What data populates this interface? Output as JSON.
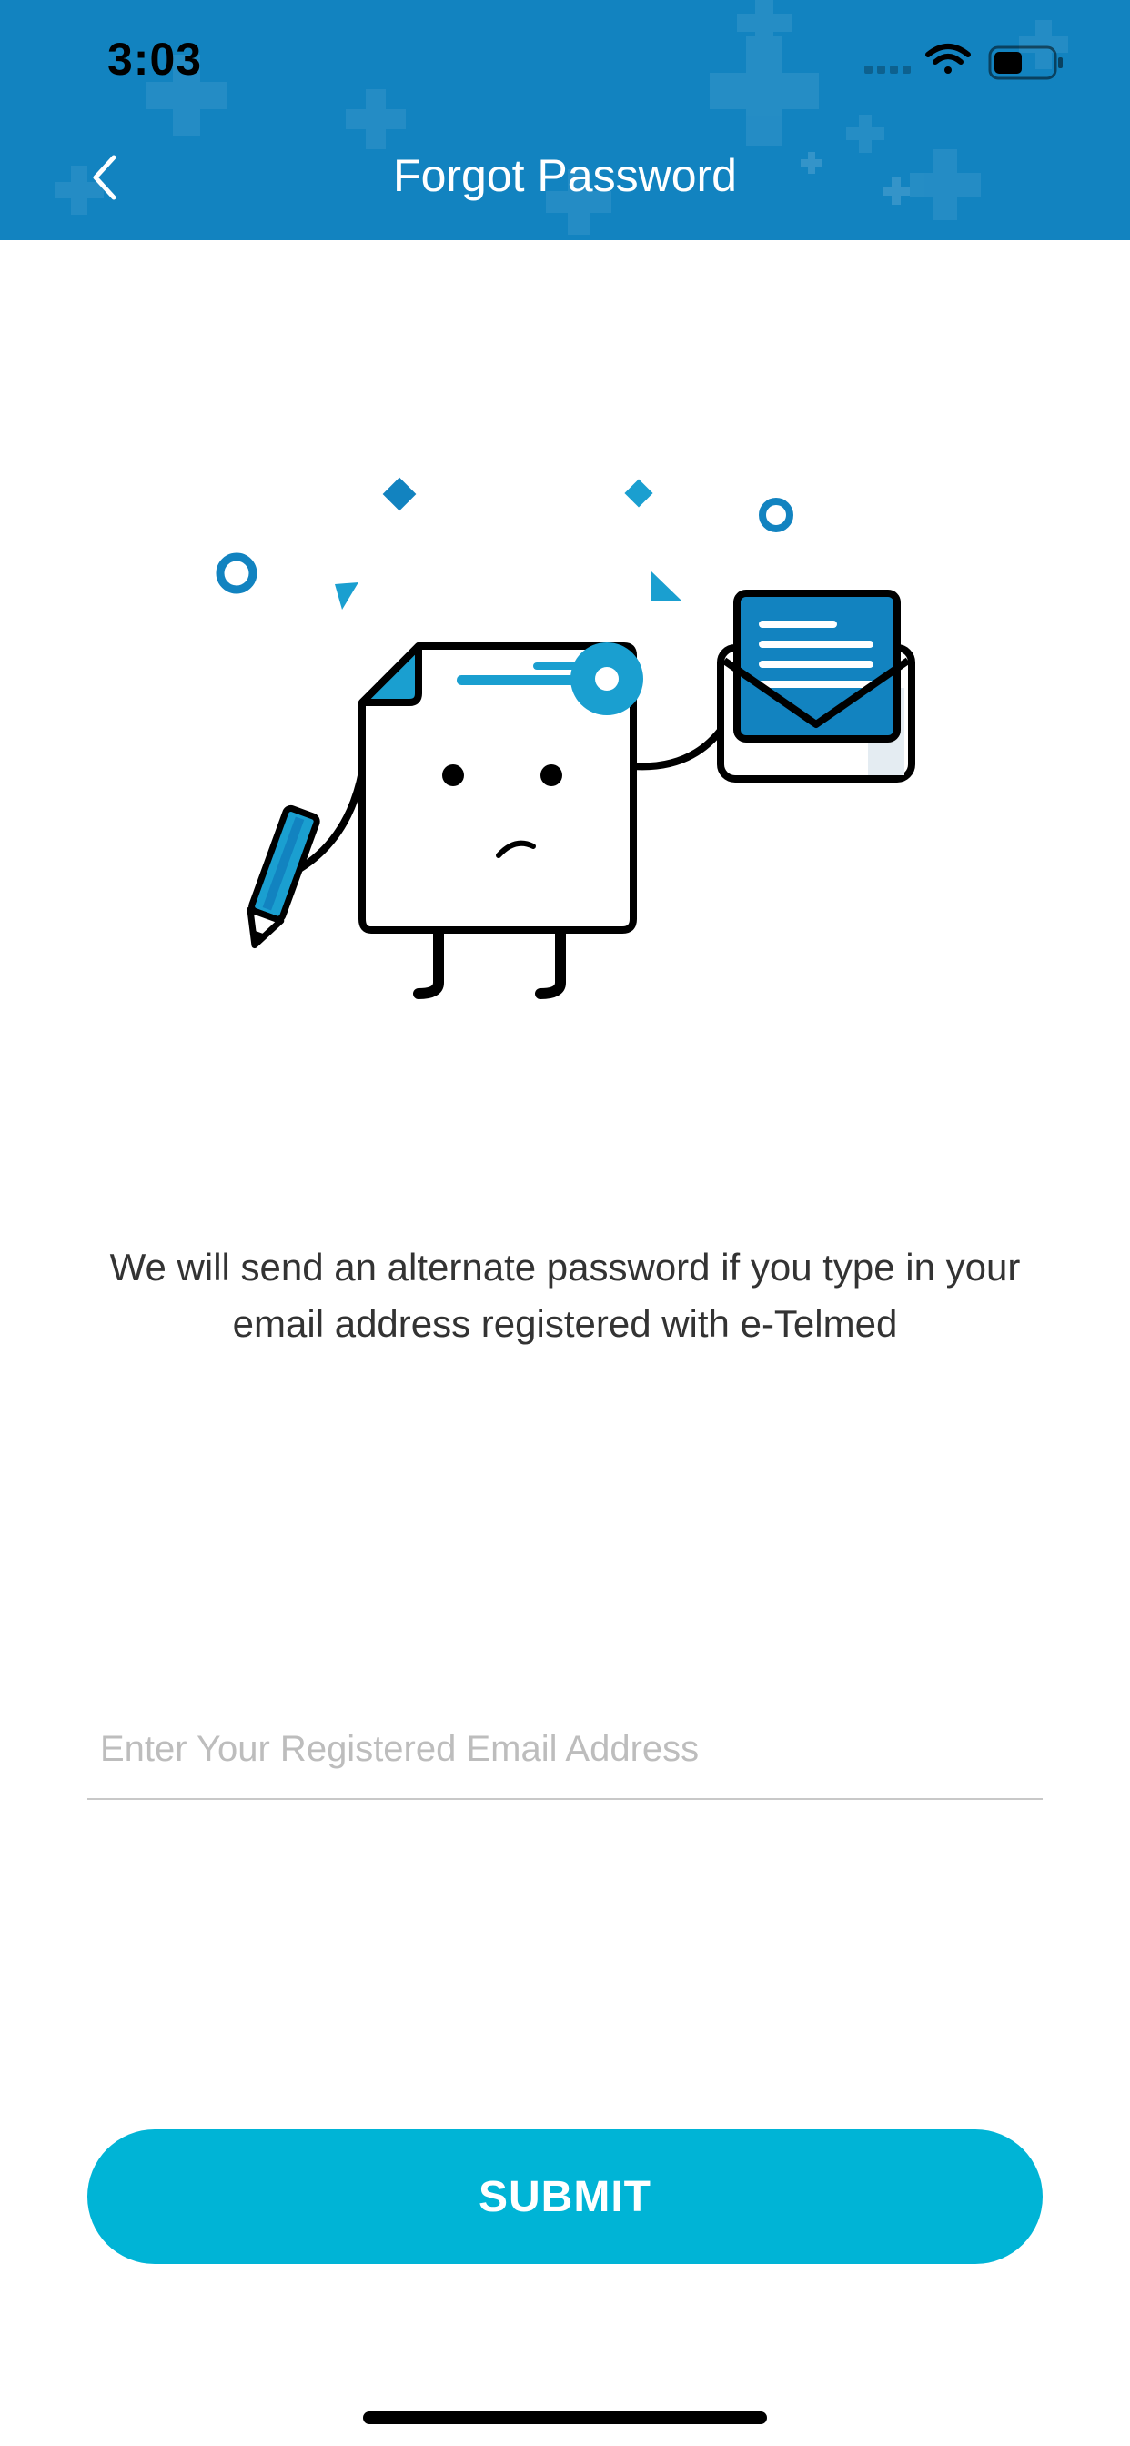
{
  "status_bar": {
    "time": "3:03",
    "icons": [
      "signal-icon",
      "wifi-icon",
      "battery-icon"
    ]
  },
  "header": {
    "title": "Forgot Password",
    "back_icon": "chevron-left-icon"
  },
  "main": {
    "description": "We will send an alternate password if you type in your email address registered with e-Telmed",
    "email_placeholder": "Enter Your Registered Email Address",
    "email_value": "",
    "submit_label": "SUBMIT"
  },
  "colors": {
    "header_bg": "#1283c0",
    "accent": "#00b4d6",
    "illustration_blue": "#1a9fd0"
  }
}
